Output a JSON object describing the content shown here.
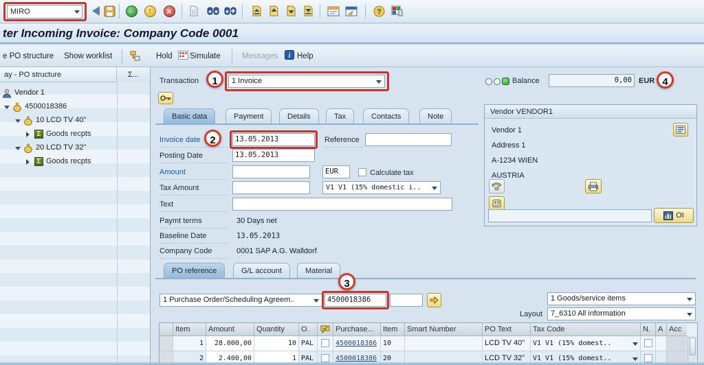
{
  "colors": {
    "highlight_red": "#c0392e",
    "active_tab_blue": "#95bada",
    "link_blue": "#1457ad",
    "balance_green": "#28a028"
  },
  "toolbar": {
    "command_value": "MIRO"
  },
  "title_bar": {
    "text": "ter Incoming Invoice: Company Code 0001"
  },
  "app_toolbar": {
    "po_structure": "e PO structure",
    "show_worklist": "Show worklist",
    "hold": "Hold",
    "simulate": "Simulate",
    "messages": "Messages",
    "help": "Help"
  },
  "po_tree": {
    "header": "ay - PO structure",
    "header_button": "Σ...",
    "nodes": [
      {
        "label": "Vendor 1"
      },
      {
        "label": "4500018386"
      },
      {
        "label": "10 LCD TV 40\""
      },
      {
        "label": "Goods recpts"
      },
      {
        "label": "20 LCD TV 32\""
      },
      {
        "label": "Goods recpts"
      }
    ]
  },
  "header_area": {
    "transaction_label": "Transaction",
    "transaction_value": "1 Invoice",
    "balance_label": "Balance",
    "balance_value": "0,00",
    "balance_currency": "EUR"
  },
  "annotations": {
    "n1": "1",
    "n2": "2",
    "n3": "3",
    "n4": "4"
  },
  "header_tabs": {
    "basic_data": "Basic data",
    "payment": "Payment",
    "details": "Details",
    "tax": "Tax",
    "contacts": "Contacts",
    "note": "Note"
  },
  "basic_data": {
    "invoice_date_label": "Invoice date",
    "invoice_date_value": "13.05.2013",
    "reference_label": "Reference",
    "reference_value": "",
    "posting_date_label": "Posting Date",
    "posting_date_value": "13.05.2013",
    "amount_label": "Amount",
    "amount_value": "",
    "currency_value": "EUR",
    "calculate_tax_label": "Calculate tax",
    "tax_amount_label": "Tax Amount",
    "tax_amount_value": "",
    "tax_code_value": "V1 V1 (15% domestic i..",
    "text_label": "Text",
    "text_value": "",
    "paymt_terms_label": "Paymt terms",
    "paymt_terms_value": "30 Days net",
    "baseline_date_label": "Baseline Date",
    "baseline_date_value": "13.05.2013",
    "company_code_label": "Company Code",
    "company_code_value": "0001 SAP A.G. Walldorf"
  },
  "vendor_panel": {
    "header": "Vendor VENDOR1",
    "line1": "Vendor 1",
    "line2": "Address 1",
    "line3": "A-1234 WIEN",
    "line4": "AUSTRIA",
    "oi_label": "OI"
  },
  "item_tabs": {
    "po_reference": "PO reference",
    "gl_account": "G/L account",
    "material": "Material"
  },
  "po_reference": {
    "doc_category": "1 Purchase Order/Scheduling Agreem..",
    "po_number": "4500018386",
    "po_item_value": "",
    "item_filter": "1 Goods/service items",
    "layout_label": "Layout",
    "layout_value": "7_6310 All information"
  },
  "items_table": {
    "columns": {
      "item": "Item",
      "amount": "Amount",
      "quantity": "Quantity",
      "ou": "O.",
      "purchase": "Purchase...",
      "item2": "Item",
      "smart_number": "Smart Number",
      "po_text": "PO Text",
      "tax_code": "Tax Code",
      "n": "N.",
      "a": "A",
      "acc": "Acc"
    },
    "rows": [
      {
        "item": "1",
        "amount": "28.000,00",
        "quantity": "10",
        "ou": "PAL",
        "purchase": "4500018386",
        "item2": "10",
        "smart_number": "",
        "po_text": "LCD TV 40\"",
        "tax_code": "V1 V1 (15% domest.."
      },
      {
        "item": "2",
        "amount": "2.400,00",
        "quantity": "1",
        "ou": "PAL",
        "purchase": "4500018386",
        "item2": "20",
        "smart_number": "",
        "po_text": "LCD TV 32\"",
        "tax_code": "V1 V1 (15% domest.."
      }
    ]
  }
}
